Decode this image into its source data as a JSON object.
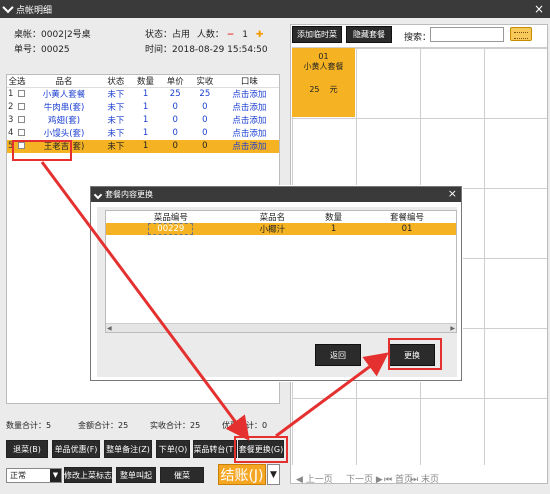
{
  "window": {
    "title": "点帐明细",
    "close": "×"
  },
  "order": {
    "table_label": "桌帐：",
    "table_value": "0002|2号桌",
    "number_label": "单号：",
    "number_value": "00025",
    "status_label": "状态：",
    "status_value": "占用",
    "people_label": "人数：",
    "people_minus": "−",
    "people_value": "1",
    "people_plus": "✚",
    "time_label": "时间：",
    "time_value": "2018-08-29 15:54:50"
  },
  "item_table": {
    "headers": [
      "全选",
      "品名",
      "状态",
      "数量",
      "单价",
      "实收",
      "口味"
    ],
    "rows": [
      {
        "idx": "1",
        "name": "小黄人套餐",
        "status": "未下",
        "qty": "1",
        "price": "25",
        "paid": "25",
        "flavor": "点击添加"
      },
      {
        "idx": "2",
        "name": "牛肉串(套)",
        "status": "未下",
        "qty": "1",
        "price": "0",
        "paid": "0",
        "flavor": "点击添加"
      },
      {
        "idx": "3",
        "name": "鸡翅(套)",
        "status": "未下",
        "qty": "1",
        "price": "0",
        "paid": "0",
        "flavor": "点击添加"
      },
      {
        "idx": "4",
        "name": "小馒头(套)",
        "status": "未下",
        "qty": "1",
        "price": "0",
        "paid": "0",
        "flavor": "点击添加"
      },
      {
        "idx": "5",
        "name": "王老吉(套)",
        "status": "未下",
        "qty": "1",
        "price": "0",
        "paid": "0",
        "flavor": "点击添加"
      }
    ]
  },
  "totals": {
    "qty_label": "数量合计：",
    "qty_value": "5",
    "amount_label": "金额合计：",
    "amount_value": "25",
    "paid_label": "实收合计：",
    "paid_value": "25",
    "discount_label": "优惠合计：",
    "discount_value": "0"
  },
  "buttons": {
    "return_dish": "退菜(B)",
    "item_discount": "单品优惠(F)",
    "order_note": "整单备注(Z)",
    "place_order": "下单(O)",
    "transfer": "菜品转台(T)",
    "package_replace": "套餐更换(G)",
    "mode_select": "正常",
    "modify_flag": "修改上菜标志",
    "whole_call": "整单叫起",
    "urge": "催菜",
    "checkout": "结账(J)",
    "checkout_arrow": "▼"
  },
  "right_panel": {
    "add_temp_dish": "添加临时菜",
    "hide_package": "隐藏套餐",
    "search_label": "搜索：",
    "search_value": "",
    "tile": {
      "code": "01",
      "name": "小黄人套餐",
      "price": "25",
      "unit": "元"
    },
    "pager": {
      "prev": "上一页",
      "next": "下一页",
      "first": "首页",
      "last": "末页"
    }
  },
  "dialog": {
    "title": "套餐内容更换",
    "close": "×",
    "headers": [
      "菜品编号",
      "菜品名",
      "数量",
      "套餐编号"
    ],
    "rows": [
      {
        "code": "00229",
        "name": "小椰汁",
        "qty": "1",
        "pkg": "01"
      }
    ],
    "back": "返回",
    "replace": "更换"
  },
  "colors": {
    "highlight": "#f5b324",
    "annotation": "#e53030",
    "dark_button": "#2b2b2b",
    "link_blue": "#1a3fd0"
  }
}
